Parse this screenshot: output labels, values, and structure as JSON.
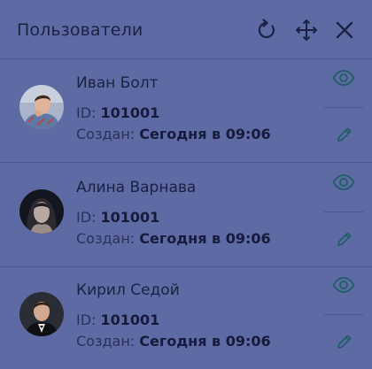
{
  "header": {
    "title": "Пользователи",
    "icons": [
      "refresh-icon",
      "move-icon",
      "close-icon"
    ]
  },
  "users": [
    {
      "name": "Иван Болт",
      "id_label": "ID:",
      "id_value": "101001",
      "created_label": "Создан:",
      "created_value": "Сегодня в 09:06"
    },
    {
      "name": "Алина Варнава",
      "id_label": "ID:",
      "id_value": "101001",
      "created_label": "Создан:",
      "created_value": "Сегодня в 09:06"
    },
    {
      "name": "Кирил Седой",
      "id_label": "ID:",
      "id_value": "101001",
      "created_label": "Создан:",
      "created_value": "Сегодня в 09:06"
    }
  ],
  "colors": {
    "background": "#5d6aa4",
    "divider": "#4b5893",
    "text": "#1b2142",
    "icon_accent": "#1f5f63"
  }
}
